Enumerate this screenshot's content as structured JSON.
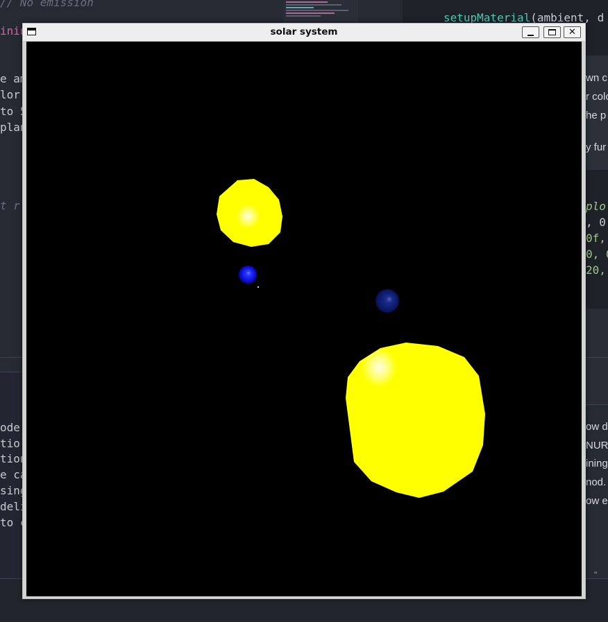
{
  "window": {
    "title": "solar system",
    "controls": {
      "minimize": "minimize-icon",
      "maximize": "maximize-icon",
      "close": "close-icon"
    }
  },
  "scene": {
    "background_color": "#000000",
    "bodies": [
      {
        "name": "sun-large",
        "color": "#ffff00"
      },
      {
        "name": "sun-small",
        "color": "#ffff00"
      },
      {
        "name": "planet-blue-bright",
        "color": "#1010e0"
      },
      {
        "name": "planet-blue-dark",
        "color": "#0a1a70"
      }
    ]
  },
  "background_editor": {
    "code_left": {
      "line1": "// No emission",
      "line2": "inin",
      "line3": "e am",
      "line4": "lor",
      "line5": "to 5",
      "line6": "plan",
      "line7": "t r"
    },
    "code_right_top": {
      "line1_fn": "setupMaterial",
      "line1_rest": "(ambient, d"
    },
    "doc_right": {
      "line1": "wn c",
      "line2": "r colo",
      "line3": "he p",
      "line4": "y fur"
    },
    "code_right_mid": {
      "line1": "plo",
      "line2": ", 0,",
      "line3": "0f,",
      "line4": "0, 0",
      "line5": "20,"
    },
    "lower_left": {
      "line1": "ode",
      "line2": "tio",
      "line3": "tion",
      "line4": "e ca",
      "line5": "sing",
      "line6": "deli",
      "line7": "to c"
    },
    "lower_right": {
      "line1": "ow d",
      "line2": "NUR",
      "line3": "ining",
      "line4": "nod.",
      "line5": "ow e"
    },
    "footer_right": "\""
  }
}
